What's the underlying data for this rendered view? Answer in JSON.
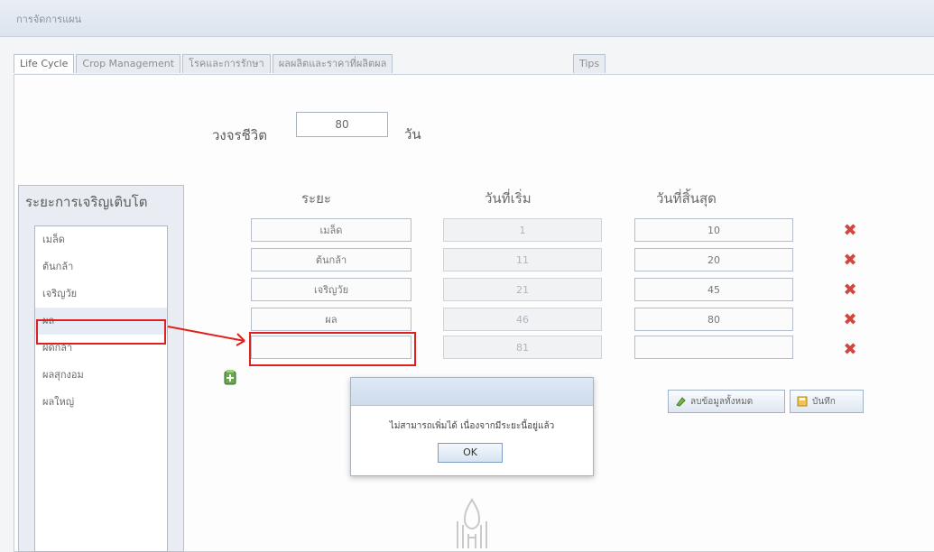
{
  "window": {
    "title": "การจัดการแผน"
  },
  "tabs": [
    {
      "label": "Life Cycle",
      "active": true
    },
    {
      "label": "Crop Management",
      "active": false
    },
    {
      "label": "โรคและการรักษา",
      "active": false
    },
    {
      "label": "ผลผลิตและราคาที่ผลิตผล",
      "active": false
    },
    {
      "label": "Tips",
      "active": false
    }
  ],
  "life_cycle": {
    "label": "วงจรชีวิต",
    "value": "80",
    "unit": "วัน"
  },
  "growth_stages": {
    "title": "ระยะการเจริญเติบโต",
    "items": [
      "เมล็ด",
      "ต้นกล้า",
      "เจริญวัย",
      "ผล",
      "ผิดกล้า",
      "ผลสุกงอม",
      "ผลใหญ่"
    ],
    "selected_index": 3
  },
  "table": {
    "headers": {
      "stage": "ระยะ",
      "start": "วันที่เริ่ม",
      "end": "วันที่สิ้นสุด"
    },
    "rows": [
      {
        "stage": "เมล็ด",
        "start": "1",
        "end": "10"
      },
      {
        "stage": "ต้นกล้า",
        "start": "11",
        "end": "20"
      },
      {
        "stage": "เจริญวัย",
        "start": "21",
        "end": "45"
      },
      {
        "stage": "ผล",
        "start": "46",
        "end": "80"
      },
      {
        "stage": "",
        "start": "81",
        "end": ""
      }
    ]
  },
  "buttons": {
    "clear_label": "ลบข้อมูลทั้งหมด",
    "save_label": "บันทึก"
  },
  "dialog": {
    "message": "ไม่สามารถเพิ่มได้ เนื่องจากมีระยะนี้อยู่แล้ว",
    "ok_label": "OK"
  },
  "colors": {
    "accent": "#e0201e",
    "delete": "#d3453e"
  }
}
